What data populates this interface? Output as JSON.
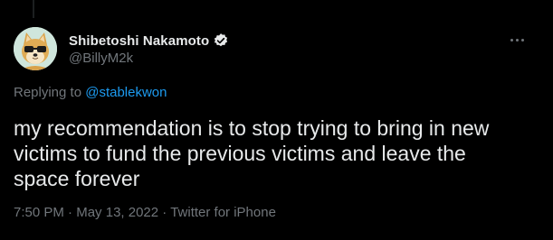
{
  "tweet": {
    "author": {
      "display_name": "Shibetoshi Nakamoto",
      "handle": "@BillyM2k",
      "verified": true,
      "avatar_icon": "shiba-dog-with-glasses-avatar"
    },
    "reply": {
      "prefix": "Replying to ",
      "mention": "@stablekwon"
    },
    "text": "my recommendation is to stop trying to bring in new\nvictims to fund the previous victims and leave the\nspace forever",
    "meta": {
      "time": "7:50 PM",
      "separator": " · ",
      "date": "May 13, 2022",
      "source": "Twitter for iPhone"
    },
    "more_icon": "more-horizontal-icon"
  },
  "colors": {
    "background": "#000000",
    "primary_text": "#e7e9ea",
    "secondary_text": "#71767b",
    "accent": "#1d9bf0",
    "verified_badge": "#e7e9ea"
  }
}
